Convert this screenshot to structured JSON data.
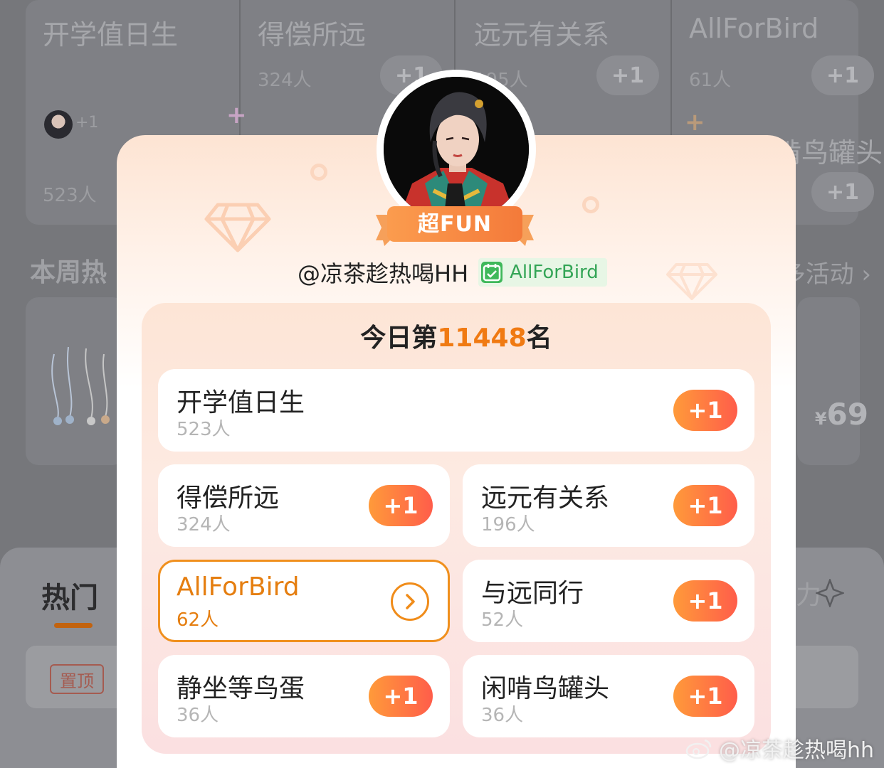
{
  "background": {
    "top_groups": [
      {
        "name": "开学值日生",
        "count": "523人"
      },
      {
        "name": "得偿所远",
        "count": "324人",
        "plus": "+1"
      },
      {
        "name": "远元有关系",
        "count": "195人",
        "plus": "+1"
      },
      {
        "name": "AllForBird",
        "count": "61人",
        "plus": "+1"
      }
    ],
    "avatar_plus": "+1",
    "partial_right": "闲啃鸟罐头",
    "right_plus": "+1",
    "weekly_title": "本周热",
    "more_link": "多活动 ›",
    "price": "69",
    "price_symbol": "¥",
    "hot_tab": "热门",
    "pin_label": "置顶",
    "tab_right": "力"
  },
  "card": {
    "badge_label": "超FUN",
    "username": "@凉茶趁热喝HH",
    "tag_label": "AllForBird",
    "rank_prefix": "今日第",
    "rank_number": "11448",
    "rank_suffix": "名",
    "groups": [
      {
        "name": "开学值日生",
        "count": "523人",
        "action": "+1"
      },
      {
        "name": "得偿所远",
        "count": "324人",
        "action": "+1"
      },
      {
        "name": "远元有关系",
        "count": "196人",
        "action": "+1"
      },
      {
        "name": "AllForBird",
        "count": "62人",
        "action": ">"
      },
      {
        "name": "与远同行",
        "count": "52人",
        "action": "+1"
      },
      {
        "name": "静坐等鸟蛋",
        "count": "36人",
        "action": "+1"
      },
      {
        "name": "闲啃鸟罐头",
        "count": "36人",
        "action": "+1"
      }
    ]
  },
  "watermark": "@凉茶趁热喝hh",
  "colors": {
    "accent_orange": "#f07a12",
    "plus_gradient_start": "#ff9a3a",
    "plus_gradient_end": "#ff5d4a",
    "tag_green": "#33a556"
  }
}
